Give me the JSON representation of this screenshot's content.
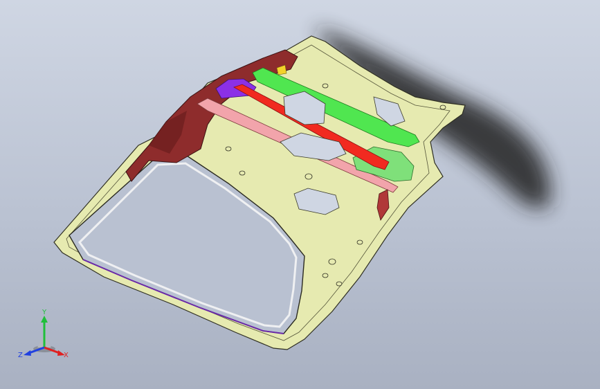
{
  "viewport": {
    "background_top": "#cfd6e3",
    "background_bottom": "#a9b1c2"
  },
  "model": {
    "panel_color": "#e8ecb0",
    "edge_color": "#3a3a2a",
    "reinforcement_color": "#8a2a2a",
    "beam_red_color": "#f02a22",
    "beam_green_color": "#4ee84a",
    "bracket_purple_color": "#8a2be2",
    "bracket_pink_color": "#f3a0a8",
    "shadow_color": "#2a2a2a"
  },
  "triad": {
    "y_label": "Y",
    "x_label": "X",
    "z_label": "Z",
    "y_color": "#1fbf3a",
    "x_color": "#e02020",
    "z_color": "#2040e0"
  }
}
